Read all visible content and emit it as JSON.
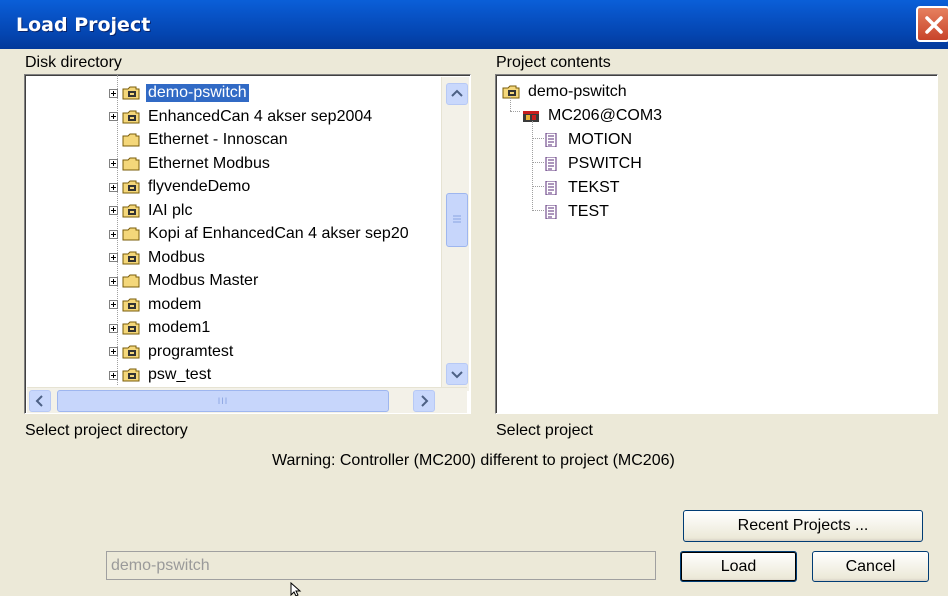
{
  "window": {
    "title": "Load Project",
    "close_icon": "close-icon"
  },
  "left_pane": {
    "heading": "Disk directory",
    "footer": "Select project directory",
    "items": [
      {
        "label": "demo-pswitch",
        "icon": "project-folder-open-icon",
        "expander": true,
        "selected": true
      },
      {
        "label": "EnhancedCan 4 akser sep2004",
        "icon": "project-folder-icon",
        "expander": true
      },
      {
        "label": "Ethernet - Innoscan",
        "icon": "folder-icon",
        "expander": false
      },
      {
        "label": "Ethernet Modbus",
        "icon": "folder-icon",
        "expander": true
      },
      {
        "label": "flyvendeDemo",
        "icon": "project-folder-icon",
        "expander": true
      },
      {
        "label": "IAI plc",
        "icon": "project-folder-icon",
        "expander": true
      },
      {
        "label": "Kopi af EnhancedCan 4 akser sep20",
        "icon": "folder-icon",
        "expander": true
      },
      {
        "label": "Modbus",
        "icon": "project-folder-icon",
        "expander": true
      },
      {
        "label": "Modbus Master",
        "icon": "folder-icon",
        "expander": true
      },
      {
        "label": "modem",
        "icon": "project-folder-icon",
        "expander": true
      },
      {
        "label": "modem1",
        "icon": "project-folder-icon",
        "expander": true
      },
      {
        "label": "programtest",
        "icon": "project-folder-icon",
        "expander": true
      },
      {
        "label": "psw_test",
        "icon": "project-folder-icon",
        "expander": true
      }
    ],
    "hscroll_grip": "III"
  },
  "right_pane": {
    "heading": "Project contents",
    "footer": "Select project",
    "root": {
      "label": "demo-pswitch",
      "icon": "project-folder-icon"
    },
    "controller": {
      "label": "MC206@COM3",
      "icon": "controller-icon"
    },
    "programs": [
      {
        "label": "MOTION",
        "icon": "document-icon"
      },
      {
        "label": "PSWITCH",
        "icon": "document-icon"
      },
      {
        "label": "TEKST",
        "icon": "document-icon"
      },
      {
        "label": "TEST",
        "icon": "document-icon"
      }
    ]
  },
  "warning": "Warning: Controller (MC200) different to project (MC206)",
  "buttons": {
    "recent": "Recent Projects ...",
    "load": "Load",
    "cancel": "Cancel"
  },
  "project_field": {
    "value": "demo-pswitch"
  },
  "colors": {
    "titlebar": "#0445b0",
    "selection": "#316ac5",
    "dialog_bg": "#ece9d8"
  }
}
